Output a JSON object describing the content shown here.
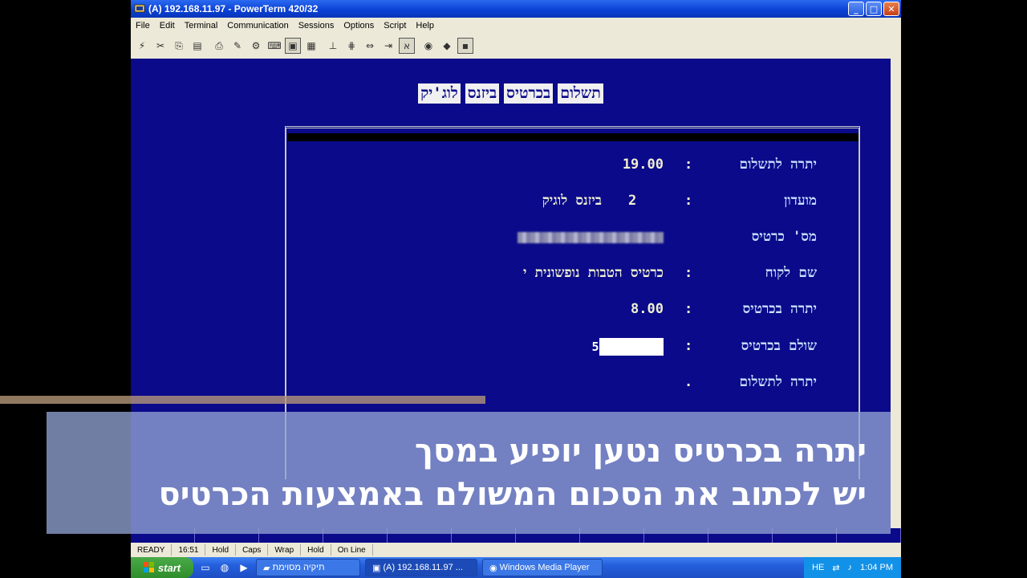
{
  "window": {
    "title": "(A) 192.168.11.97 - PowerTerm 420/32"
  },
  "menu": [
    "File",
    "Edit",
    "Terminal",
    "Communication",
    "Sessions",
    "Options",
    "Script",
    "Help"
  ],
  "screen": {
    "title_words": [
      "תשלום",
      "בכרטיס",
      "ביזנס",
      "לוג'יק"
    ],
    "fields": [
      {
        "label": "יתרה לתשלום",
        "value": "19.00"
      },
      {
        "label": "מועדון",
        "number": "2",
        "value": "ביזנס לוגיק"
      },
      {
        "label": "מס' כרטיס"
      },
      {
        "label": "שם לקוח",
        "value": "כרטיס הטבות נופשונית י"
      },
      {
        "label": "יתרה בכרטיס",
        "value": "8.00"
      },
      {
        "label": "שולם בכרטיס",
        "input": "5"
      },
      {
        "label": "יתרה לתשלום"
      }
    ]
  },
  "status": [
    "READY",
    "16:51",
    "Hold",
    "Caps",
    "Wrap",
    "Hold",
    "On Line"
  ],
  "taskbar": {
    "start": "start",
    "tasks": [
      "תיקיה מסוימת",
      "(A) 192.168.11.97 ...",
      "Windows Media Player"
    ],
    "clock": "1:04 PM"
  },
  "overlay": {
    "line1": "יתרה בכרטיס נטען יופיע במסך",
    "line2": "יש לכתוב את הסכום המשולם באמצעות הכרטיס"
  },
  "colors": {
    "terminal_bg": "#0a0a8a",
    "terminal_text": "#f0f0d0",
    "label_text": "#c9e0ff",
    "overlay_bg": "#91a2d2"
  }
}
